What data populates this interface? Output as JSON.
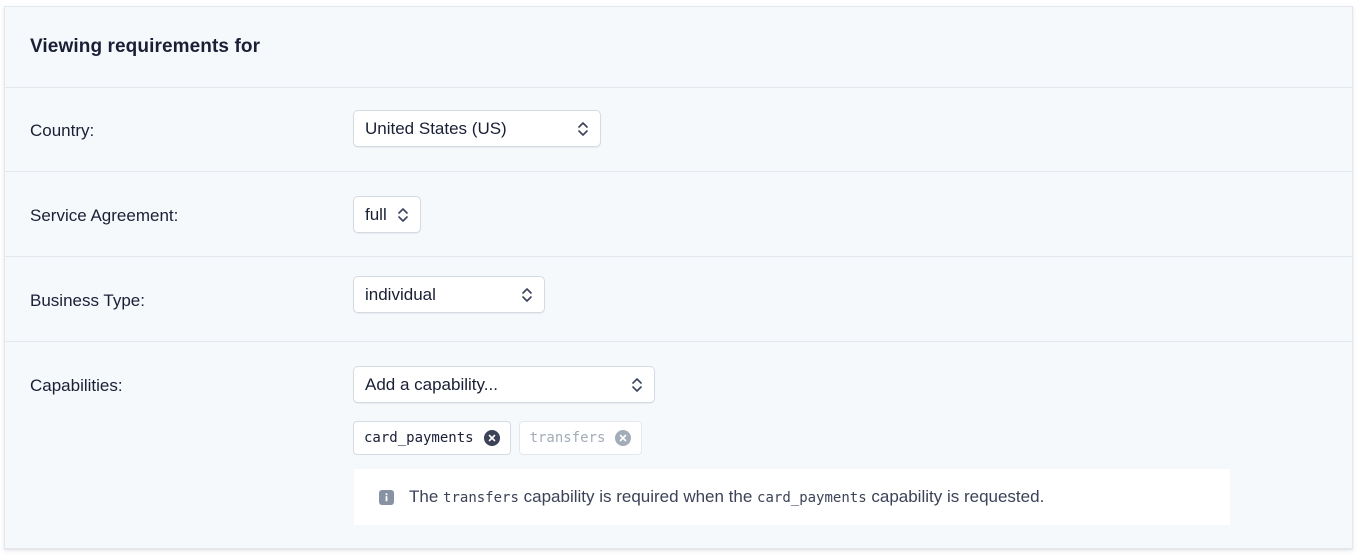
{
  "header": {
    "title": "Viewing requirements for"
  },
  "fields": {
    "country": {
      "label": "Country:",
      "value": "United States (US)"
    },
    "service_agreement": {
      "label": "Service Agreement:",
      "value": "full"
    },
    "business_type": {
      "label": "Business Type:",
      "value": "individual"
    },
    "capabilities": {
      "label": "Capabilities:",
      "placeholder": "Add a capability...",
      "chips": [
        {
          "label": "card_payments",
          "state": "active"
        },
        {
          "label": "transfers",
          "state": "disabled"
        }
      ]
    }
  },
  "notice": {
    "icon": "info-icon",
    "text_1": "The",
    "code_1": "transfers",
    "text_2": "capability is required when the",
    "code_2": "card_payments",
    "text_3": "capability is requested."
  },
  "colors": {
    "card_bg": "#f6f9fc",
    "border": "#e3e8ee",
    "text": "#1a1f36",
    "muted": "#a3acb9"
  }
}
